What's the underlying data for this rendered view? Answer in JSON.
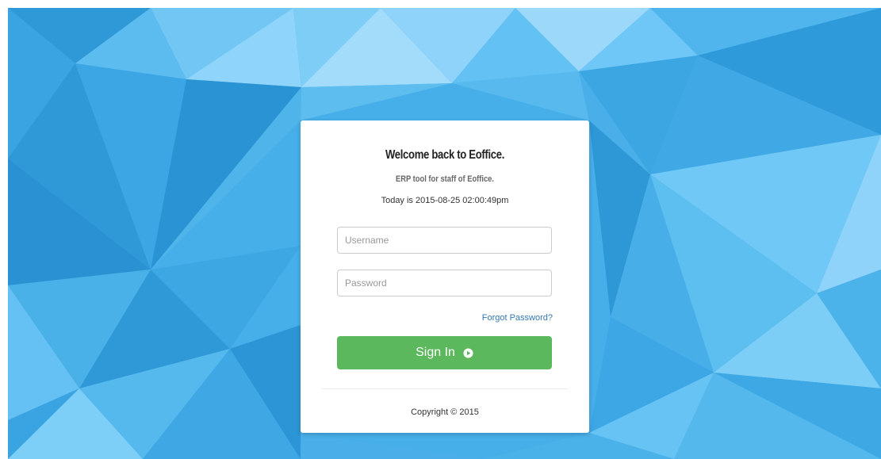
{
  "colors": {
    "background_primary": "#3ea9e6",
    "card_background": "#ffffff",
    "button_green": "#5cb85c",
    "link_blue": "#3278b3"
  },
  "login": {
    "title": "Welcome back to Eoffice.",
    "subtitle": "ERP tool for staff of Eoffice.",
    "date_text": "Today is 2015-08-25 02:00:49pm",
    "username_placeholder": "Username",
    "username_value": "",
    "password_placeholder": "Password",
    "password_value": "",
    "forgot_label": "Forgot Password?",
    "signin_label": "Sign In",
    "signin_icon": "play-circle-icon",
    "copyright": "Copyright © 2015"
  }
}
